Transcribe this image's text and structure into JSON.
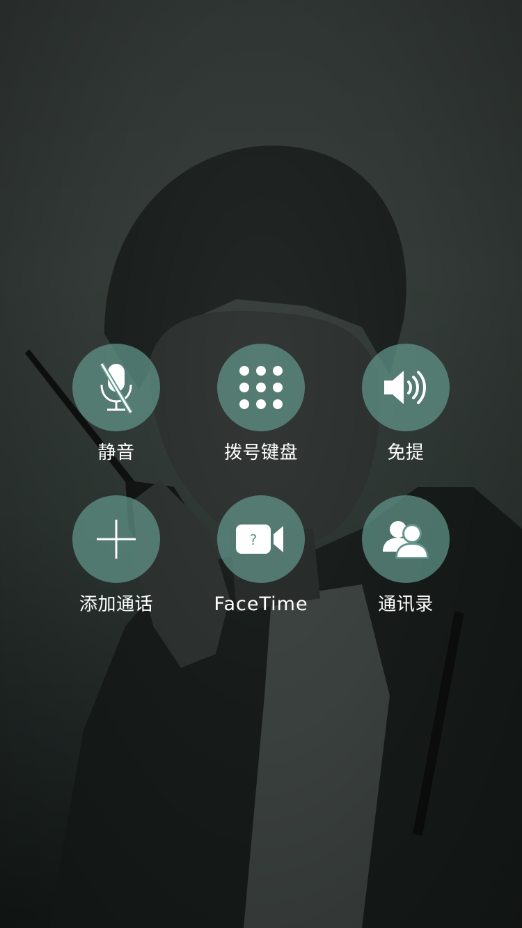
{
  "call_controls": {
    "mute": {
      "label": "静音",
      "icon": "mic-muted-icon"
    },
    "keypad": {
      "label": "拨号键盘",
      "icon": "keypad-grid-icon"
    },
    "speaker": {
      "label": "免提",
      "icon": "speaker-icon"
    },
    "add_call": {
      "label": "添加通话",
      "icon": "plus-icon"
    },
    "facetime": {
      "label": "FaceTime",
      "icon": "video-camera-question-icon",
      "badge": "?"
    },
    "contacts": {
      "label": "通讯录",
      "icon": "contacts-people-icon"
    }
  },
  "colors": {
    "button_fill": "#62968a",
    "background": "#2f3533",
    "label": "#ffffff"
  }
}
